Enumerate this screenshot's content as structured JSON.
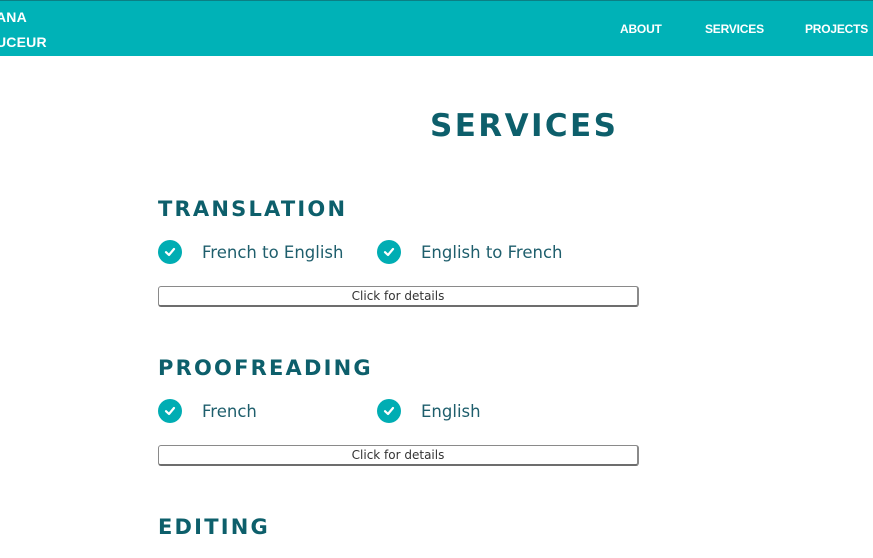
{
  "header": {
    "brand_line1": "ANA",
    "brand_line2": "UCEUR",
    "nav": {
      "about": "ABOUT",
      "services": "SERVICES",
      "projects": "PROJECTS"
    },
    "background_color": "#00b2b7"
  },
  "main": {
    "title": "SERVICES",
    "sections": [
      {
        "heading": "TRANSLATION",
        "items": [
          "French to English",
          "English to French"
        ],
        "button_label": "Click for details"
      },
      {
        "heading": "PROOFREADING",
        "items": [
          "French",
          "English"
        ],
        "button_label": "Click for details"
      },
      {
        "heading": "EDITING"
      }
    ]
  },
  "colors": {
    "heading": "#0d5f6b",
    "check_badge": "#00adb3",
    "item_text": "#1e5e6c"
  },
  "icons": {
    "check": "check-circle-icon"
  }
}
